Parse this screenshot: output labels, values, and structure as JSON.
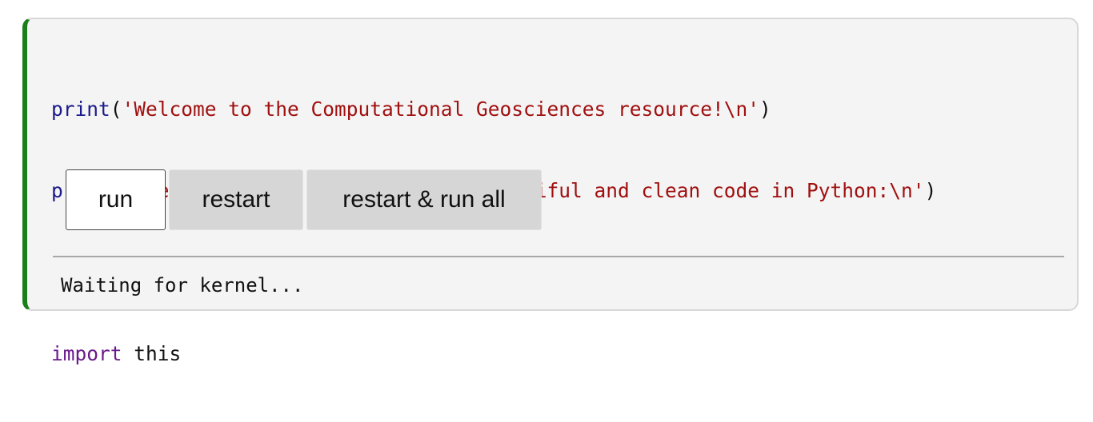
{
  "cell": {
    "accent_color": "#1a7f1a",
    "code_lines": [
      {
        "fn": "print",
        "open": "(",
        "string": "'Welcome to the Computational Geosciences resource!\\n'",
        "close": ")"
      },
      {
        "fn": "print",
        "open": "(",
        "string": "'See below some tips to write beautiful and clean code in Python:\\n'",
        "close": ")"
      }
    ],
    "import_line": {
      "keyword": "import",
      "module": "this"
    }
  },
  "buttons": {
    "run": "run",
    "restart": "restart",
    "restart_run_all": "restart & run all"
  },
  "output": {
    "status": "Waiting for kernel..."
  }
}
